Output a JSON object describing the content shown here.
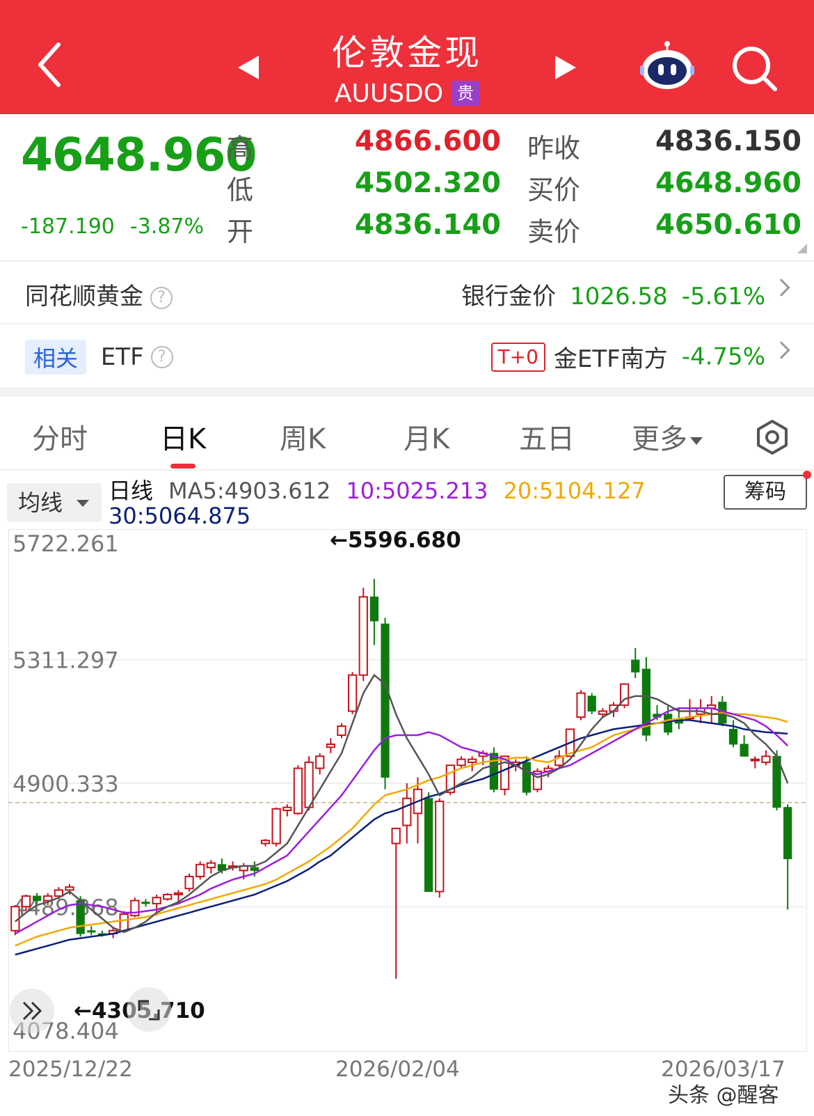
{
  "header": {
    "title": "伦敦金现",
    "code": "AUUSDO",
    "tag": "贵",
    "bg_color": "#ee303b"
  },
  "quote": {
    "price": "4648.960",
    "change": "-187.190",
    "change_pct": "-3.87%",
    "high_label": "高",
    "high": "4866.600",
    "low_label": "低",
    "low": "4502.320",
    "open_label": "开",
    "open": "4836.140",
    "prev_close_label": "昨收",
    "prev_close": "4836.150",
    "bid_label": "买价",
    "bid": "4648.960",
    "ask_label": "卖价",
    "ask": "4650.610"
  },
  "gold_row": {
    "label": "同花顺黄金",
    "bank_label": "银行金价",
    "bank_price": "1026.58",
    "bank_change": "-5.61%"
  },
  "etf_row": {
    "tag": "相关",
    "label": "ETF",
    "t0": "T+0",
    "fund_name": "金ETF南方",
    "fund_change": "-4.75%"
  },
  "tabs": [
    "分时",
    "日K",
    "周K",
    "月K",
    "五日",
    "更多"
  ],
  "active_tab": "日K",
  "ma": {
    "selector": "均线",
    "period": "日线",
    "ma5": "MA5:4903.612",
    "ma10": "10:5025.213",
    "ma20": "20:5104.127",
    "ma30": "30:5064.875",
    "chip_button": "筹码",
    "colors": {
      "ma5": "#555555",
      "ma10": "#9b1de0",
      "ma20": "#f0a800",
      "ma30": "#0a1f7a"
    }
  },
  "chart_data": {
    "type": "candlestick",
    "y_ticks": [
      "5722.261",
      "5311.297",
      "4900.333",
      "4489.368",
      "4078.404"
    ],
    "ylim": [
      4078.404,
      5722.261
    ],
    "x_labels": [
      "2025/12/22",
      "2026/02/04",
      "2026/03/17"
    ],
    "max_marker": "←5596.680",
    "min_marker": "←4305.710",
    "reference_price": 4836.15,
    "up_color": "#c8121a",
    "down_color": "#0e7a0e",
    "candles": [
      [
        4410,
        4495,
        4395,
        4490
      ],
      [
        4490,
        4530,
        4475,
        4525
      ],
      [
        4525,
        4535,
        4500,
        4510
      ],
      [
        4510,
        4535,
        4495,
        4525
      ],
      [
        4525,
        4555,
        4515,
        4545
      ],
      [
        4545,
        4565,
        4530,
        4555
      ],
      [
        4510,
        4525,
        4390,
        4400
      ],
      [
        4410,
        4425,
        4395,
        4405
      ],
      [
        4400,
        4410,
        4390,
        4395
      ],
      [
        4400,
        4420,
        4385,
        4410
      ],
      [
        4410,
        4475,
        4405,
        4465
      ],
      [
        4460,
        4520,
        4455,
        4510
      ],
      [
        4505,
        4515,
        4490,
        4500
      ],
      [
        4500,
        4530,
        4460,
        4520
      ],
      [
        4515,
        4535,
        4510,
        4530
      ],
      [
        4530,
        4545,
        4505,
        4535
      ],
      [
        4550,
        4600,
        4540,
        4590
      ],
      [
        4590,
        4640,
        4580,
        4630
      ],
      [
        4620,
        4645,
        4600,
        4635
      ],
      [
        4630,
        4650,
        4600,
        4610
      ],
      [
        4620,
        4640,
        4610,
        4625
      ],
      [
        4610,
        4635,
        4580,
        4625
      ],
      [
        4620,
        4640,
        4590,
        4610
      ],
      [
        4700,
        4715,
        4690,
        4710
      ],
      [
        4700,
        4820,
        4690,
        4815
      ],
      [
        4810,
        4830,
        4790,
        4820
      ],
      [
        4800,
        4960,
        4795,
        4950
      ],
      [
        4820,
        4990,
        4810,
        4970
      ],
      [
        4950,
        5000,
        4930,
        4990
      ],
      [
        5020,
        5050,
        5000,
        5030
      ],
      [
        5060,
        5100,
        5050,
        5090
      ],
      [
        5140,
        5270,
        5130,
        5260
      ],
      [
        5260,
        5550,
        5240,
        5520
      ],
      [
        5520,
        5580,
        5360,
        5440
      ],
      [
        5430,
        5450,
        4880,
        4920
      ],
      [
        4700,
        4740,
        4250,
        4750
      ],
      [
        4760,
        4900,
        4700,
        4850
      ],
      [
        4800,
        4920,
        4700,
        4880
      ],
      [
        4850,
        4870,
        4540,
        4540
      ],
      [
        4540,
        4850,
        4520,
        4840
      ],
      [
        4870,
        4950,
        4860,
        4960
      ],
      [
        4960,
        4990,
        4950,
        4980
      ],
      [
        4970,
        4990,
        4940,
        4980
      ],
      [
        4990,
        5010,
        4960,
        5000
      ],
      [
        5000,
        5020,
        4870,
        4880
      ],
      [
        4880,
        4990,
        4860,
        4990
      ],
      [
        4960,
        4980,
        4940,
        4970
      ],
      [
        4970,
        4990,
        4860,
        4870
      ],
      [
        4880,
        4950,
        4870,
        4940
      ],
      [
        4940,
        4960,
        4920,
        4950
      ],
      [
        4960,
        5010,
        4950,
        4990
      ],
      [
        4990,
        5080,
        4990,
        5080
      ],
      [
        5120,
        5210,
        5110,
        5200
      ],
      [
        5190,
        5200,
        5130,
        5140
      ],
      [
        5130,
        5150,
        5120,
        5140
      ],
      [
        5140,
        5170,
        5120,
        5160
      ],
      [
        5160,
        5230,
        5150,
        5230
      ],
      [
        5310,
        5350,
        5250,
        5270
      ],
      [
        5280,
        5320,
        5040,
        5060
      ],
      [
        5130,
        5160,
        5110,
        5120
      ],
      [
        5130,
        5160,
        5060,
        5070
      ],
      [
        5110,
        5150,
        5080,
        5100
      ],
      [
        5120,
        5180,
        5110,
        5120
      ],
      [
        5130,
        5180,
        5100,
        5150
      ],
      [
        5150,
        5190,
        5100,
        5160
      ],
      [
        5170,
        5190,
        5090,
        5100
      ],
      [
        5080,
        5110,
        5020,
        5030
      ],
      [
        5030,
        5060,
        4990,
        4990
      ],
      [
        4980,
        4990,
        4950,
        4980
      ],
      [
        4970,
        5010,
        4960,
        4990
      ],
      [
        4990,
        5010,
        4810,
        4820
      ],
      [
        4820,
        4830,
        4480,
        4649
      ]
    ],
    "ma5": [
      4440,
      4470,
      4495,
      4505,
      4520,
      4540,
      4510,
      4480,
      4450,
      4420,
      4405,
      4420,
      4440,
      4470,
      4490,
      4505,
      4530,
      4560,
      4590,
      4610,
      4620,
      4625,
      4625,
      4640,
      4670,
      4700,
      4760,
      4820,
      4880,
      4940,
      5000,
      5100,
      5200,
      5260,
      5230,
      5130,
      5050,
      4990,
      4930,
      4860,
      4880,
      4900,
      4920,
      4950,
      4960,
      4970,
      4960,
      4940,
      4920,
      4930,
      4950,
      4980,
      5030,
      5080,
      5120,
      5140,
      5180,
      5190,
      5190,
      5180,
      5160,
      5140,
      5140,
      5140,
      5130,
      5130,
      5120,
      5100,
      5060,
      5030,
      4990,
      4900
    ],
    "ma10": [
      4400,
      4420,
      4440,
      4460,
      4480,
      4495,
      4500,
      4495,
      4490,
      4480,
      4470,
      4470,
      4475,
      4480,
      4490,
      4500,
      4515,
      4530,
      4550,
      4565,
      4580,
      4590,
      4600,
      4620,
      4640,
      4660,
      4700,
      4740,
      4780,
      4820,
      4860,
      4910,
      4960,
      5010,
      5050,
      5060,
      5060,
      5060,
      5070,
      5060,
      5040,
      5020,
      5010,
      5000,
      4990,
      4980,
      4960,
      4940,
      4930,
      4940,
      4950,
      4960,
      4980,
      5000,
      5020,
      5040,
      5060,
      5080,
      5100,
      5120,
      5140,
      5150,
      5150,
      5150,
      5150,
      5140,
      5130,
      5120,
      5110,
      5090,
      5060,
      5025
    ],
    "ma20": [
      4360,
      4375,
      4390,
      4400,
      4410,
      4420,
      4425,
      4430,
      4435,
      4440,
      4445,
      4450,
      4455,
      4465,
      4475,
      4485,
      4495,
      4505,
      4515,
      4525,
      4535,
      4545,
      4555,
      4565,
      4580,
      4600,
      4620,
      4640,
      4665,
      4690,
      4720,
      4750,
      4790,
      4830,
      4860,
      4870,
      4880,
      4895,
      4910,
      4920,
      4935,
      4950,
      4960,
      4970,
      4975,
      4980,
      4985,
      4985,
      4975,
      4970,
      4985,
      5000,
      5010,
      5020,
      5040,
      5060,
      5070,
      5080,
      5090,
      5100,
      5110,
      5115,
      5120,
      5125,
      5130,
      5135,
      5130,
      5130,
      5125,
      5120,
      5115,
      5104
    ],
    "ma30": [
      4330,
      4340,
      4350,
      4360,
      4370,
      4380,
      4385,
      4390,
      4395,
      4400,
      4410,
      4420,
      4430,
      4440,
      4450,
      4460,
      4470,
      4480,
      4490,
      4500,
      4510,
      4520,
      4530,
      4545,
      4560,
      4575,
      4595,
      4615,
      4640,
      4660,
      4690,
      4720,
      4750,
      4780,
      4800,
      4810,
      4825,
      4840,
      4855,
      4865,
      4880,
      4895,
      4905,
      4915,
      4930,
      4945,
      4960,
      4975,
      4990,
      5005,
      5020,
      5035,
      5050,
      5060,
      5070,
      5080,
      5085,
      5090,
      5095,
      5100,
      5105,
      5110,
      5110,
      5105,
      5100,
      5095,
      5090,
      5080,
      5075,
      5070,
      5068,
      5065
    ]
  },
  "watermark": "头条 @醒客"
}
